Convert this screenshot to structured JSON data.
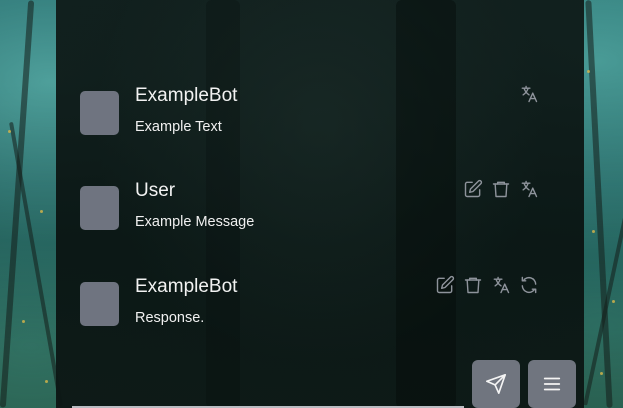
{
  "messages": [
    {
      "name": "ExampleBot",
      "text": "Example Text",
      "actions": [
        "translate-icon"
      ]
    },
    {
      "name": "User",
      "text": "Example Message",
      "actions": [
        "edit-icon",
        "delete-icon",
        "translate-icon"
      ]
    },
    {
      "name": "ExampleBot",
      "text": "Response.",
      "actions": [
        "edit-icon",
        "delete-icon",
        "translate-icon",
        "regenerate-icon"
      ]
    }
  ],
  "controls": {
    "send_icon": "send-icon",
    "menu_icon": "menu-icon"
  },
  "colors": {
    "panel": "#0e1816",
    "avatar": "#6f7480",
    "icon": "#8e939b",
    "button": "#70757f"
  }
}
